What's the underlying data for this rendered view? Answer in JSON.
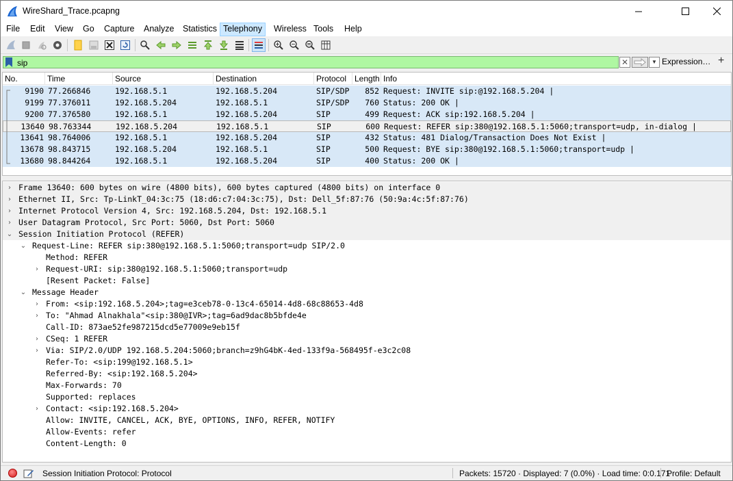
{
  "window": {
    "title": "WireShard_Trace.pcapng",
    "minimize": "—",
    "maximize": "☐",
    "close": "✕"
  },
  "menu": [
    "File",
    "Edit",
    "View",
    "Go",
    "Capture",
    "Analyze",
    "Statistics",
    "Telephony",
    "Wireless",
    "Tools",
    "Help"
  ],
  "menu_active": "Telephony",
  "toolbar_icons": [
    "shark-fin-start-icon",
    "stop-icon",
    "restart-icon",
    "options-icon",
    "open-file-icon",
    "save-file-icon",
    "close-file-icon",
    "reload-icon",
    "find-icon",
    "go-back-icon",
    "go-forward-icon",
    "go-to-packet-icon",
    "first-packet-icon",
    "last-packet-icon",
    "autoscroll-icon",
    "colorize-icon",
    "zoom-in-icon",
    "zoom-out-icon",
    "normal-size-icon",
    "resize-columns-icon"
  ],
  "filter": {
    "value": "sip",
    "expression_label": "Expression…",
    "plus_label": "+",
    "clear_label": "✕",
    "dropdown_label": "▼"
  },
  "packet_list": {
    "columns": [
      "No.",
      "Time",
      "Source",
      "Destination",
      "Protocol",
      "Length",
      "Info"
    ],
    "rows": [
      {
        "no": "9190",
        "time": "77.266846",
        "src": "192.168.5.1",
        "dst": "192.168.5.204",
        "proto": "SIP/SDP",
        "len": "852",
        "info": "Request: INVITE sip:@192.168.5.204 |"
      },
      {
        "no": "9199",
        "time": "77.376011",
        "src": "192.168.5.204",
        "dst": "192.168.5.1",
        "proto": "SIP/SDP",
        "len": "760",
        "info": "Status: 200 OK |"
      },
      {
        "no": "9200",
        "time": "77.376580",
        "src": "192.168.5.1",
        "dst": "192.168.5.204",
        "proto": "SIP",
        "len": "499",
        "info": "Request: ACK sip:192.168.5.204 |"
      },
      {
        "no": "13640",
        "time": "98.763344",
        "src": "192.168.5.204",
        "dst": "192.168.5.1",
        "proto": "SIP",
        "len": "600",
        "info": "Request: REFER sip:380@192.168.5.1:5060;transport=udp, in-dialog |"
      },
      {
        "no": "13641",
        "time": "98.764006",
        "src": "192.168.5.1",
        "dst": "192.168.5.204",
        "proto": "SIP",
        "len": "432",
        "info": "Status: 481 Dialog/Transaction Does Not Exist |"
      },
      {
        "no": "13678",
        "time": "98.843715",
        "src": "192.168.5.204",
        "dst": "192.168.5.1",
        "proto": "SIP",
        "len": "500",
        "info": "Request: BYE sip:380@192.168.5.1:5060;transport=udp |"
      },
      {
        "no": "13680",
        "time": "98.844264",
        "src": "192.168.5.1",
        "dst": "192.168.5.204",
        "proto": "SIP",
        "len": "400",
        "info": "Status: 200 OK |"
      }
    ],
    "selected_index": 3
  },
  "details": [
    {
      "text": "Frame 13640: 600 bytes on wire (4800 bits), 600 bytes captured (4800 bits) on interface 0",
      "level": 0,
      "arrow": "›"
    },
    {
      "text": "Ethernet II, Src: Tp-LinkT_04:3c:75 (18:d6:c7:04:3c:75), Dst: Dell_5f:87:76 (50:9a:4c:5f:87:76)",
      "level": 0,
      "arrow": "›"
    },
    {
      "text": "Internet Protocol Version 4, Src: 192.168.5.204, Dst: 192.168.5.1",
      "level": 0,
      "arrow": "›"
    },
    {
      "text": "User Datagram Protocol, Src Port: 5060, Dst Port: 5060",
      "level": 0,
      "arrow": "›"
    },
    {
      "text": "Session Initiation Protocol (REFER)",
      "level": 0,
      "arrow": "⌄"
    },
    {
      "text": "Request-Line: REFER sip:380@192.168.5.1:5060;transport=udp SIP/2.0",
      "level": 1,
      "arrow": "⌄"
    },
    {
      "text": "Method: REFER",
      "level": 2,
      "arrow": ""
    },
    {
      "text": "Request-URI: sip:380@192.168.5.1:5060;transport=udp",
      "level": 2,
      "arrow": "›"
    },
    {
      "text": "[Resent Packet: False]",
      "level": 2,
      "arrow": ""
    },
    {
      "text": "Message Header",
      "level": 1,
      "arrow": "⌄"
    },
    {
      "text": "From: <sip:192.168.5.204>;tag=e3ceb78-0-13c4-65014-4d8-68c88653-4d8",
      "level": 2,
      "arrow": "›"
    },
    {
      "text": "To: \"Ahmad Alnakhala\"<sip:380@IVR>;tag=6ad9dac8b5bfde4e",
      "level": 2,
      "arrow": "›"
    },
    {
      "text": "Call-ID: 873ae52fe987215dcd5e77009e9eb15f",
      "level": 2,
      "arrow": ""
    },
    {
      "text": "CSeq: 1 REFER",
      "level": 2,
      "arrow": "›"
    },
    {
      "text": "Via: SIP/2.0/UDP 192.168.5.204:5060;branch=z9hG4bK-4ed-133f9a-568495f-e3c2c08",
      "level": 2,
      "arrow": "›"
    },
    {
      "text": "Refer-To: <sip:199@192.168.5.1>",
      "level": 2,
      "arrow": ""
    },
    {
      "text": "Referred-By: <sip:192.168.5.204>",
      "level": 2,
      "arrow": ""
    },
    {
      "text": "Max-Forwards: 70",
      "level": 2,
      "arrow": ""
    },
    {
      "text": "Supported: replaces",
      "level": 2,
      "arrow": ""
    },
    {
      "text": "Contact: <sip:192.168.5.204>",
      "level": 2,
      "arrow": "›"
    },
    {
      "text": "Allow: INVITE, CANCEL, ACK, BYE, OPTIONS, INFO, REFER, NOTIFY",
      "level": 2,
      "arrow": ""
    },
    {
      "text": "Allow-Events: refer",
      "level": 2,
      "arrow": ""
    },
    {
      "text": "Content-Length: 0",
      "level": 2,
      "arrow": ""
    }
  ],
  "status": {
    "protocol_text": "Session Initiation Protocol: Protocol",
    "packets_text": "Packets: 15720 · Displayed: 7 (0.0%) · Load time: 0:0.171",
    "profile_text": "Profile: Default"
  },
  "colors": {
    "row_bg": "#d8e8f7",
    "filter_valid_bg": "#aff7a2",
    "menu_active_bg": "#cce8ff"
  }
}
